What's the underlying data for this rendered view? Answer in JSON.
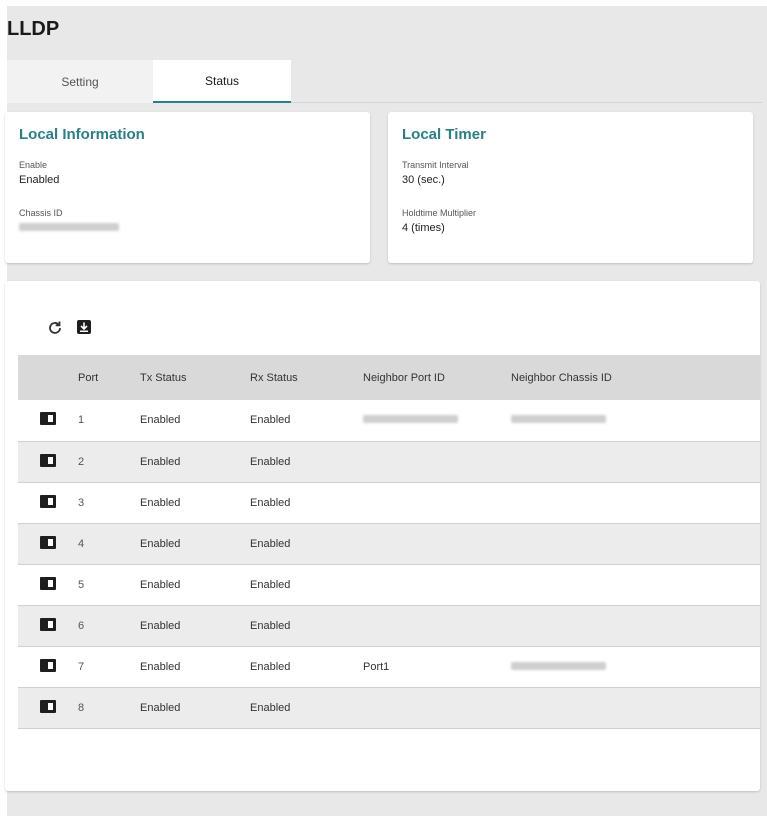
{
  "page": {
    "title": "LLDP"
  },
  "tabs": [
    {
      "label": "Setting",
      "active": false
    },
    {
      "label": "Status",
      "active": true
    }
  ],
  "local_information": {
    "title": "Local Information",
    "enable_label": "Enable",
    "enable_value": "Enabled",
    "chassis_id_label": "Chassis ID"
  },
  "local_timer": {
    "title": "Local Timer",
    "transmit_interval_label": "Transmit Interval",
    "transmit_interval_value": "30 (sec.)",
    "holdtime_multiplier_label": "Holdtime Multiplier",
    "holdtime_multiplier_value": "4 (times)"
  },
  "toolbar": {
    "refresh_icon": "refresh-icon",
    "export_icon": "download-icon"
  },
  "table": {
    "columns": [
      "Port",
      "Tx Status",
      "Rx Status",
      "Neighbor Port ID",
      "Neighbor Chassis ID"
    ],
    "rows": [
      {
        "port": "1",
        "tx": "Enabled",
        "rx": "Enabled",
        "neighbor_port": "",
        "neighbor_chassis": ""
      },
      {
        "port": "2",
        "tx": "Enabled",
        "rx": "Enabled",
        "neighbor_port": "",
        "neighbor_chassis": ""
      },
      {
        "port": "3",
        "tx": "Enabled",
        "rx": "Enabled",
        "neighbor_port": "",
        "neighbor_chassis": ""
      },
      {
        "port": "4",
        "tx": "Enabled",
        "rx": "Enabled",
        "neighbor_port": "",
        "neighbor_chassis": ""
      },
      {
        "port": "5",
        "tx": "Enabled",
        "rx": "Enabled",
        "neighbor_port": "",
        "neighbor_chassis": ""
      },
      {
        "port": "6",
        "tx": "Enabled",
        "rx": "Enabled",
        "neighbor_port": "",
        "neighbor_chassis": ""
      },
      {
        "port": "7",
        "tx": "Enabled",
        "rx": "Enabled",
        "neighbor_port": "Port1",
        "neighbor_chassis": ""
      },
      {
        "port": "8",
        "tx": "Enabled",
        "rx": "Enabled",
        "neighbor_port": "",
        "neighbor_chassis": ""
      }
    ]
  },
  "colors": {
    "accent": "#2a7f86",
    "background": "#e8e8e8",
    "header_row": "#d9d9d9"
  }
}
